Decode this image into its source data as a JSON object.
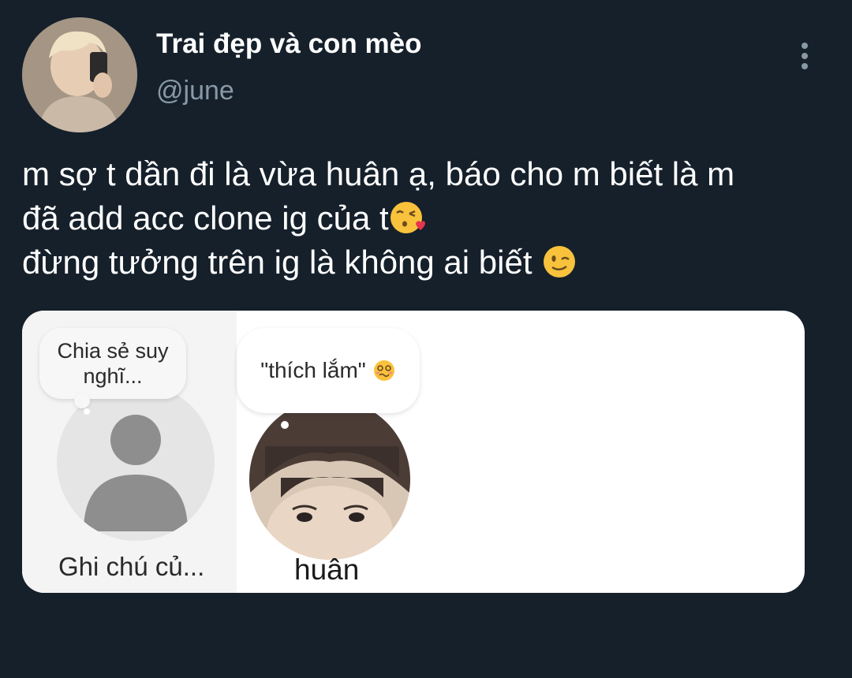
{
  "tweet": {
    "author": {
      "display_name": "Trai đẹp và con mèo",
      "handle": "@june",
      "avatar_icon": "profile-photo-avatar"
    },
    "more_icon": "more-options-vertical-icon",
    "text_lines": [
      "m sợ t dần đi là vừa huân ạ, báo cho m biết là m",
      "đã add acc clone ig của t",
      "đừng tưởng trên ig là không ai biết "
    ],
    "emojis": {
      "line2_end": "kissing-heart-emoji",
      "line3_end": "winking-face-emoji"
    }
  },
  "media": {
    "notes": [
      {
        "bubble_text": "Chia sẻ suy nghĩ...",
        "label": "Ghi chú củ...",
        "avatar_icon": "default-user-silhouette-icon"
      },
      {
        "bubble_text": "\"thích lắm\"",
        "bubble_emoji": "woozy-face-emoji",
        "label": "huân",
        "avatar_icon": "user-photo-avatar"
      }
    ]
  },
  "colors": {
    "background": "#15202b",
    "text_primary": "#ffffff",
    "text_secondary": "#8899a6",
    "card_background": "#ffffff"
  }
}
